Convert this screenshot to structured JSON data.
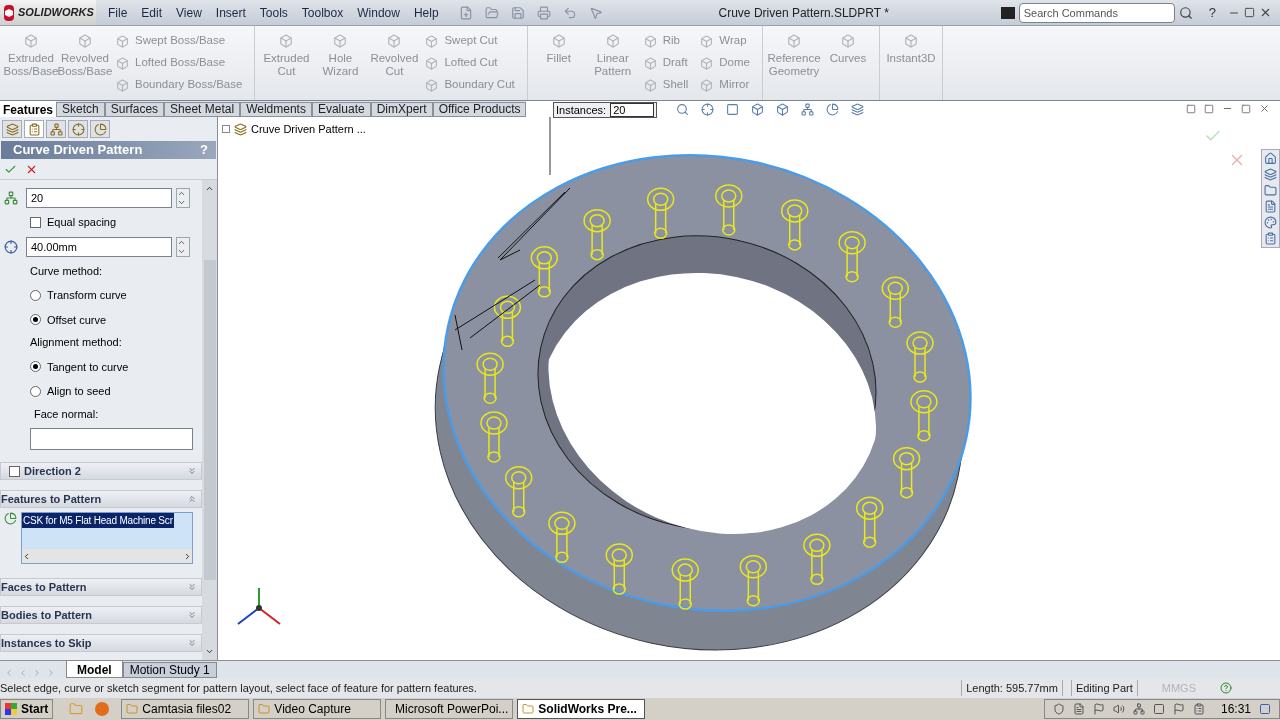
{
  "app": {
    "logo": "SOLIDWORKS",
    "menus": [
      "File",
      "Edit",
      "View",
      "Insert",
      "Tools",
      "Toolbox",
      "Window",
      "Help"
    ],
    "title": "Cruve Driven Pattern.SLDPRT *",
    "search": {
      "placeholder": "Search Commands"
    },
    "help": "?"
  },
  "ribbon": {
    "groups": [
      [
        {
          "kind": "large",
          "label": "Extruded Boss/Base"
        },
        {
          "kind": "large",
          "label": "Revolved Boss/Base"
        },
        {
          "kind": "stack",
          "items": [
            "Swept Boss/Base",
            "Lofted Boss/Base",
            "Boundary Boss/Base"
          ]
        }
      ],
      [
        {
          "kind": "large",
          "label": "Extruded Cut"
        },
        {
          "kind": "large",
          "label": "Hole Wizard"
        },
        {
          "kind": "large",
          "label": "Revolved Cut"
        },
        {
          "kind": "stack",
          "items": [
            "Swept Cut",
            "Lofted Cut",
            "Boundary Cut"
          ]
        }
      ],
      [
        {
          "kind": "large",
          "label": "Fillet"
        },
        {
          "kind": "large",
          "label": "Linear Pattern"
        },
        {
          "kind": "stack",
          "items": [
            "Rib",
            "Draft",
            "Shell"
          ]
        },
        {
          "kind": "stack",
          "items": [
            "Wrap",
            "Dome",
            "Mirror"
          ]
        }
      ],
      [
        {
          "kind": "large",
          "label": "Reference Geometry"
        },
        {
          "kind": "large",
          "label": "Curves"
        }
      ],
      [
        {
          "kind": "large",
          "label": "Instant3D"
        }
      ]
    ]
  },
  "command_tabs": [
    {
      "label": "Features",
      "selected": true
    },
    {
      "label": "Sketch",
      "selected": false
    },
    {
      "label": "Surfaces",
      "selected": false
    },
    {
      "label": "Sheet Metal",
      "selected": false
    },
    {
      "label": "Weldments",
      "selected": false
    },
    {
      "label": "Evaluate",
      "selected": false
    },
    {
      "label": "DimXpert",
      "selected": false
    },
    {
      "label": "Office Products",
      "selected": false
    }
  ],
  "callout": {
    "label": "Instances:",
    "value": "20"
  },
  "manager_tabs": [
    {
      "selected": false
    },
    {
      "selected": true
    },
    {
      "selected": false
    },
    {
      "selected": false
    },
    {
      "selected": false
    }
  ],
  "panel": {
    "title": "Curve Driven Pattern",
    "help": "?",
    "instances": "20",
    "equal_spacing": {
      "label": "Equal spacing",
      "checked": false
    },
    "spacing": "40.00mm",
    "curve_method": {
      "label": "Curve method:",
      "options": [
        {
          "label": "Transform curve",
          "selected": false
        },
        {
          "label": "Offset curve",
          "selected": true
        }
      ]
    },
    "alignment_method": {
      "label": "Alignment method:",
      "options": [
        {
          "label": "Tangent to curve",
          "selected": true
        },
        {
          "label": "Align to seed",
          "selected": false
        }
      ]
    },
    "face_normal": {
      "label": "Face normal:"
    },
    "direction2": {
      "label": "Direction 2",
      "checked": false
    },
    "sections": [
      {
        "label": "Features to Pattern",
        "expanded": true,
        "items": [
          {
            "label": "CSK for M5 Flat Head Machine Scr",
            "selected": true
          }
        ]
      },
      {
        "label": "Faces to Pattern",
        "expanded": false
      },
      {
        "label": "Bodies to Pattern",
        "expanded": false
      },
      {
        "label": "Instances to Skip",
        "expanded": false
      }
    ]
  },
  "tree_root": "Cruve Driven Pattern  ...",
  "bottom_tabs": [
    {
      "label": "Model",
      "selected": true
    },
    {
      "label": "Motion Study 1",
      "selected": false
    }
  ],
  "status": {
    "message": "Select edge, curve or sketch segment for pattern layout, select face of feature for pattern features.",
    "length": "Length: 595.77mm",
    "mode": "Editing Part",
    "units": "MMGS"
  },
  "taskbar": {
    "start": "Start",
    "items": [
      {
        "label": "Camtasia files02",
        "selected": false
      },
      {
        "label": "Video Capture",
        "selected": false
      },
      {
        "label": "Microsoft PowerPoi...",
        "selected": false
      },
      {
        "label": "SolidWorks Pre...",
        "selected": true
      }
    ],
    "clock": "16:31"
  }
}
